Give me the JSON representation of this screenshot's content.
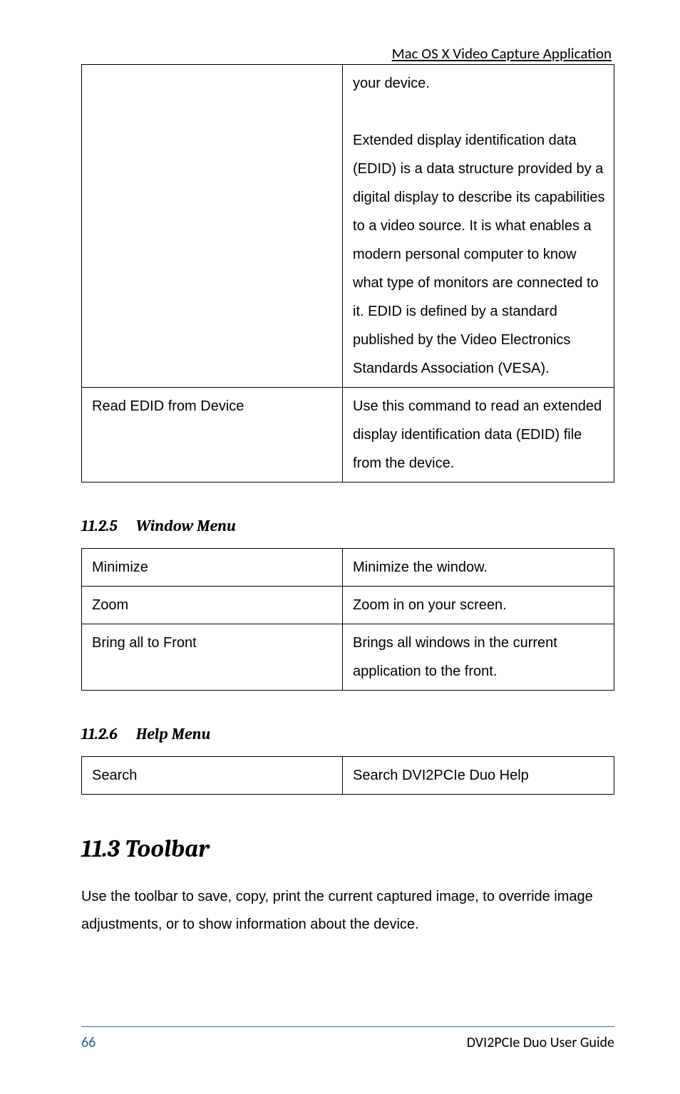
{
  "header": {
    "title": "Mac OS X Video Capture Application"
  },
  "table1": {
    "r1c1": "",
    "r1c2": "your device.\n\nExtended display identification data (EDID) is a data structure provided by a digital display to describe its capabilities to a video source. It is what enables a modern personal computer to know what type of monitors are connected to it. EDID is defined by a standard published by the Video Electronics Standards Association (VESA).",
    "r2c1": "Read EDID from Device",
    "r2c2": "Use this command to read an extended display identification data (EDID) file from the device."
  },
  "sections": {
    "window_num": "11.2.5",
    "window_title": "Window Menu",
    "help_num": "11.2.6",
    "help_title": "Help Menu",
    "toolbar_num": "11.3",
    "toolbar_title": "Toolbar"
  },
  "table2": {
    "r1c1": "Minimize",
    "r1c2": "Minimize the window.",
    "r2c1": "Zoom",
    "r2c2": "Zoom in on your screen.",
    "r3c1": "Bring all to Front",
    "r3c2": "Brings all windows in the current application to the front."
  },
  "table3": {
    "r1c1": "Search",
    "r1c2": "Search DVI2PCIe Duo Help"
  },
  "toolbar_para": "Use the toolbar to save, copy, print the current captured image, to override image adjustments, or to show information about the device.",
  "footer": {
    "page": "66",
    "doc": "DVI2PCIe Duo User Guide"
  }
}
